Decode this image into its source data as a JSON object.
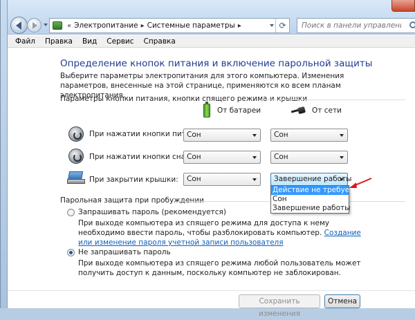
{
  "window": {
    "breadcrumb": [
      "Электропитание",
      "Системные параметры"
    ],
    "search_placeholder": "Поиск в панели управления"
  },
  "menu": [
    "Файл",
    "Правка",
    "Вид",
    "Сервис",
    "Справка"
  ],
  "page": {
    "title": "Определение кнопок питания и включение парольной защиты",
    "description": "Выберите параметры электропитания для этого компьютера. Изменения параметров, внесенные на этой странице, применяются ко всем планам электропитания."
  },
  "buttons_section": {
    "heading": "Параметры кнопки питания, кнопки спящего режима и крышки",
    "col_battery": "От батареи",
    "col_ac": "От сети",
    "rows": [
      {
        "label": "При нажатии кнопки питания:",
        "battery": "Сон",
        "ac": "Сон"
      },
      {
        "label": "При нажатии кнопки сна:",
        "battery": "Сон",
        "ac": "Сон"
      },
      {
        "label": "При закрытии крышки:",
        "battery": "Сон",
        "ac": "Завершение работы"
      }
    ],
    "dropdown_options": [
      "Действие не требуется",
      "Сон",
      "Завершение работы"
    ]
  },
  "wake_section": {
    "heading": "Парольная защита при пробуждении",
    "opt1_label": "Запрашивать пароль (рекомендуется)",
    "opt1_desc": "При выходе компьютера из спящего режима для доступа к нему необходимо ввести пароль, чтобы разблокировать компьютер.",
    "opt1_link": "Создание или изменение пароля учетной записи пользователя",
    "opt2_label": "Не запрашивать пароль",
    "opt2_desc": "При выходе компьютера из спящего режима любой пользователь может получить доступ к данным, поскольку компьютер не заблокирован.",
    "selected": "opt2"
  },
  "footer": {
    "save_label": "Сохранить изменения",
    "cancel_label": "Отмена"
  },
  "colors": {
    "accent": "#1e3d8f",
    "selection": "#3399ff",
    "link": "#0e5fb7",
    "annotation": "#e0141a"
  }
}
